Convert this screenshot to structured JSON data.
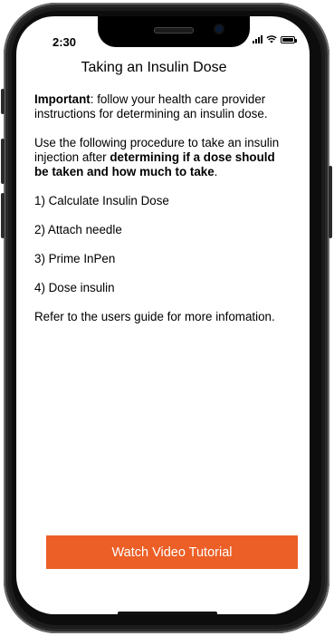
{
  "status_bar": {
    "time": "2:30",
    "signal_icon": "signal-bars-icon",
    "wifi_icon": "wifi-icon",
    "battery_icon": "battery-icon"
  },
  "screen": {
    "title": "Taking an Insulin Dose",
    "important": {
      "lead": "Important",
      "rest": ": follow your health care provider instructions for determining an insulin dose."
    },
    "procedure": {
      "text_before": "Use the following procedure to take an insulin injection after ",
      "bold": "determining if a dose should be taken and how much to take",
      "text_after": "."
    },
    "steps": [
      "1) Calculate Insulin Dose",
      "2) Attach needle",
      "3) Prime InPen",
      "4) Dose insulin"
    ],
    "footer_note": "Refer to the users guide for more infomation.",
    "cta_label": "Watch Video Tutorial"
  },
  "colors": {
    "accent": "#ec5f26",
    "phone_frame": "#1c1c1c",
    "text": "#000000"
  }
}
